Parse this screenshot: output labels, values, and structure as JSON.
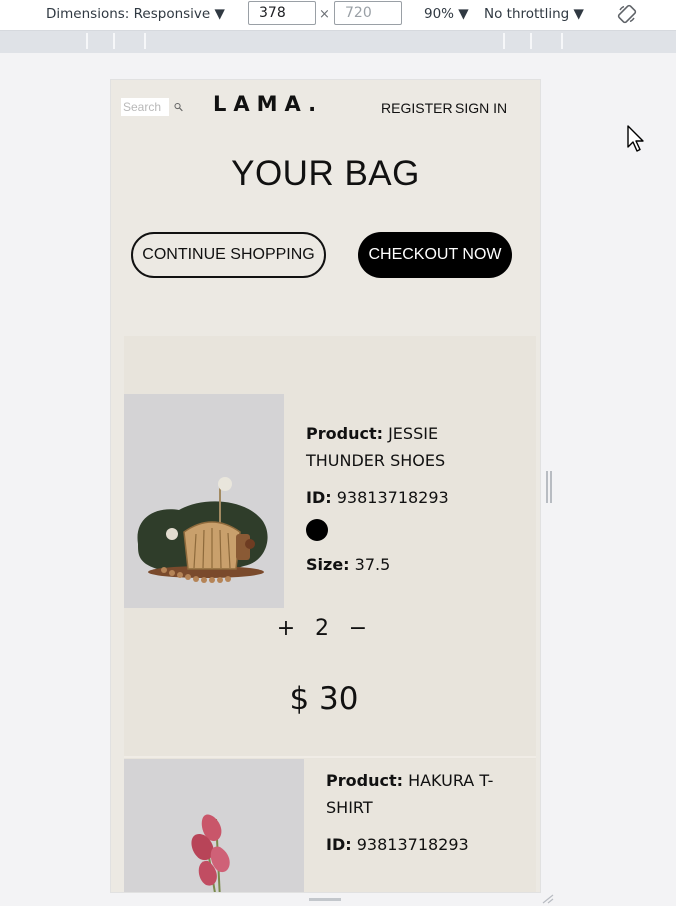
{
  "devtools": {
    "dimensions_label": "Dimensions: Responsive ▼",
    "width_value": "378",
    "times": "×",
    "height_value": "720",
    "zoom_label": "90% ▼",
    "throttle_label": "No throttling ▼",
    "rotate_icon": "rotate-icon"
  },
  "navbar": {
    "search_placeholder": "Search",
    "logo": "LAMA.",
    "register": "REGISTER",
    "signin": "SIGN IN"
  },
  "page": {
    "title": "YOUR BAG",
    "continue_button": "CONTINUE SHOPPING",
    "checkout_button": "CHECKOUT NOW"
  },
  "products": [
    {
      "product_label": "Product:",
      "product_name": "JESSIE THUNDER SHOES",
      "id_label": "ID:",
      "id_value": "93813718293",
      "color": "#000000",
      "size_label": "Size:",
      "size_value": "37.5",
      "plus": "+",
      "quantity": "2",
      "minus": "−",
      "price": "$ 30"
    },
    {
      "product_label": "Product:",
      "product_name": "HAKURA T-SHIRT",
      "id_label": "ID:",
      "id_value": "93813718293"
    }
  ],
  "colors": {
    "viewport_bg": "#ece9e3",
    "cart_bg": "#e8e4dc",
    "accent": "#000000"
  }
}
